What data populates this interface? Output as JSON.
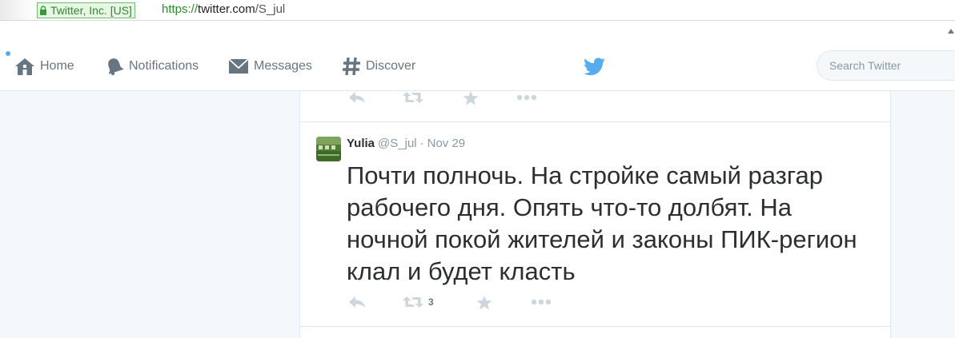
{
  "browser": {
    "secure_label": "Twitter, Inc. [US]",
    "url_scheme": "https://",
    "url_host": "twitter.com",
    "url_path": "/S_jul"
  },
  "nav": {
    "home": "Home",
    "notifications": "Notifications",
    "messages": "Messages",
    "discover": "Discover",
    "search_placeholder": "Search Twitter"
  },
  "tweet": {
    "name": "Yulia",
    "handle": "@S_jul",
    "separator": "·",
    "time": "Nov 29",
    "text": "Почти полночь. На стройке самый разгар рабочего дня. Опять что-то долбят. На ночной покой жителей и законы ПИК-регион клал и будет класть",
    "retweet_count": "3"
  },
  "colors": {
    "brand": "#55acee",
    "icon_gray": "#ccd6dd",
    "nav_gray": "#66757f"
  },
  "icons": [
    "lock-icon",
    "home-icon",
    "notifications-bell-icon",
    "messages-envelope-icon",
    "discover-hash-icon",
    "twitter-bird-icon",
    "reply-icon",
    "retweet-icon",
    "favorite-star-icon",
    "more-icon"
  ]
}
